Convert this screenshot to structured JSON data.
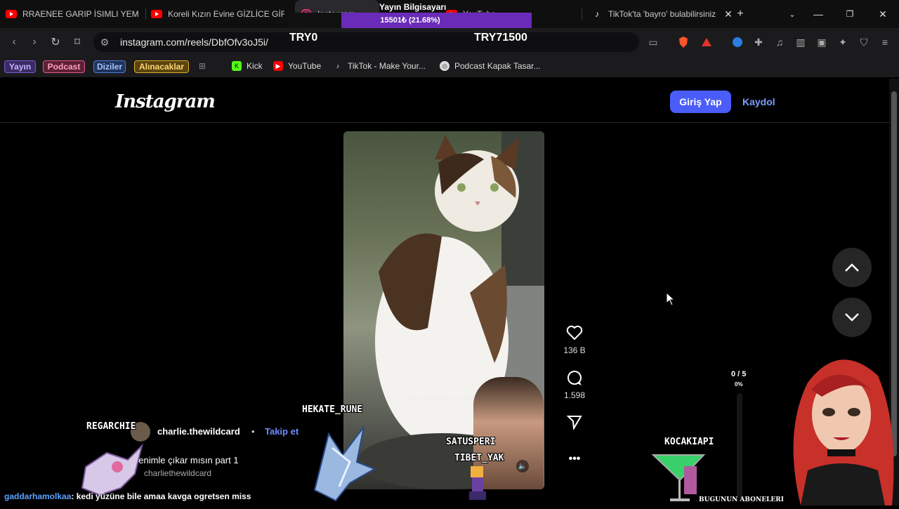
{
  "browser": {
    "tabs": [
      {
        "title": "RRAENEE GARIP İSIMLI YEME",
        "icon": "youtube-icon"
      },
      {
        "title": "Koreli Kızın Evine GİZLİCE GİR",
        "icon": "youtube-icon"
      },
      {
        "title": "Instagram",
        "icon": "instagram-icon"
      },
      {
        "title": "YouTube",
        "icon": "youtube-icon"
      },
      {
        "title": "TikTok'ta 'bayro' bulabilirsiniz",
        "icon": "tiktok-icon"
      }
    ],
    "url": "instagram.com/reels/DbfOfv3oJ5i/",
    "bookmarks_pills": [
      {
        "label": "Yayın",
        "color": "#7b5cd6"
      },
      {
        "label": "Podcast",
        "color": "#e05a8a"
      },
      {
        "label": "Diziler",
        "color": "#4b7bd8"
      },
      {
        "label": "Alınacaklar",
        "color": "#e0b030"
      }
    ],
    "bookmarks": [
      {
        "label": "Kick",
        "icon": "kick-icon"
      },
      {
        "label": "YouTube",
        "icon": "youtube-icon"
      },
      {
        "label": "TikTok - Make Your...",
        "icon": "tiktok-icon"
      },
      {
        "label": "Podcast Kapak Tasar...",
        "icon": "canva-icon"
      }
    ]
  },
  "stream_overlay": {
    "title": "Yayın Bilgisayarı",
    "progress_text": "15501₺ (21.68%)",
    "progress": 0.2168,
    "left_value": "TRY0",
    "right_value": "TRY71500"
  },
  "instagram": {
    "logo": "Instagram",
    "login": "Giriş Yap",
    "signup": "Kaydol",
    "likes": "136 B",
    "comments": "1.598",
    "user": "charlie.thewildcard",
    "follow": "Takip et",
    "caption": "benimle çıkar mısın part 1",
    "audio": "charliethewildcard",
    "video_subtitle": "Yani değil gibi yapıyor ama"
  },
  "overlay_names": {
    "n1": "REGARCHIE",
    "n2": "HEKATE_RUNE",
    "n3": "SATUSPERI",
    "n4": "TIBET_YAK",
    "n5": "KOCAKIAPI",
    "counter": "0 / 5",
    "counter_pct": "0%",
    "subs_label": "BUGUNUN ABONELERI"
  },
  "chat": {
    "user": "gaddarhamolkaa",
    "message": ": kedi yüzüne bile amaa kavga ogretsen miss"
  }
}
